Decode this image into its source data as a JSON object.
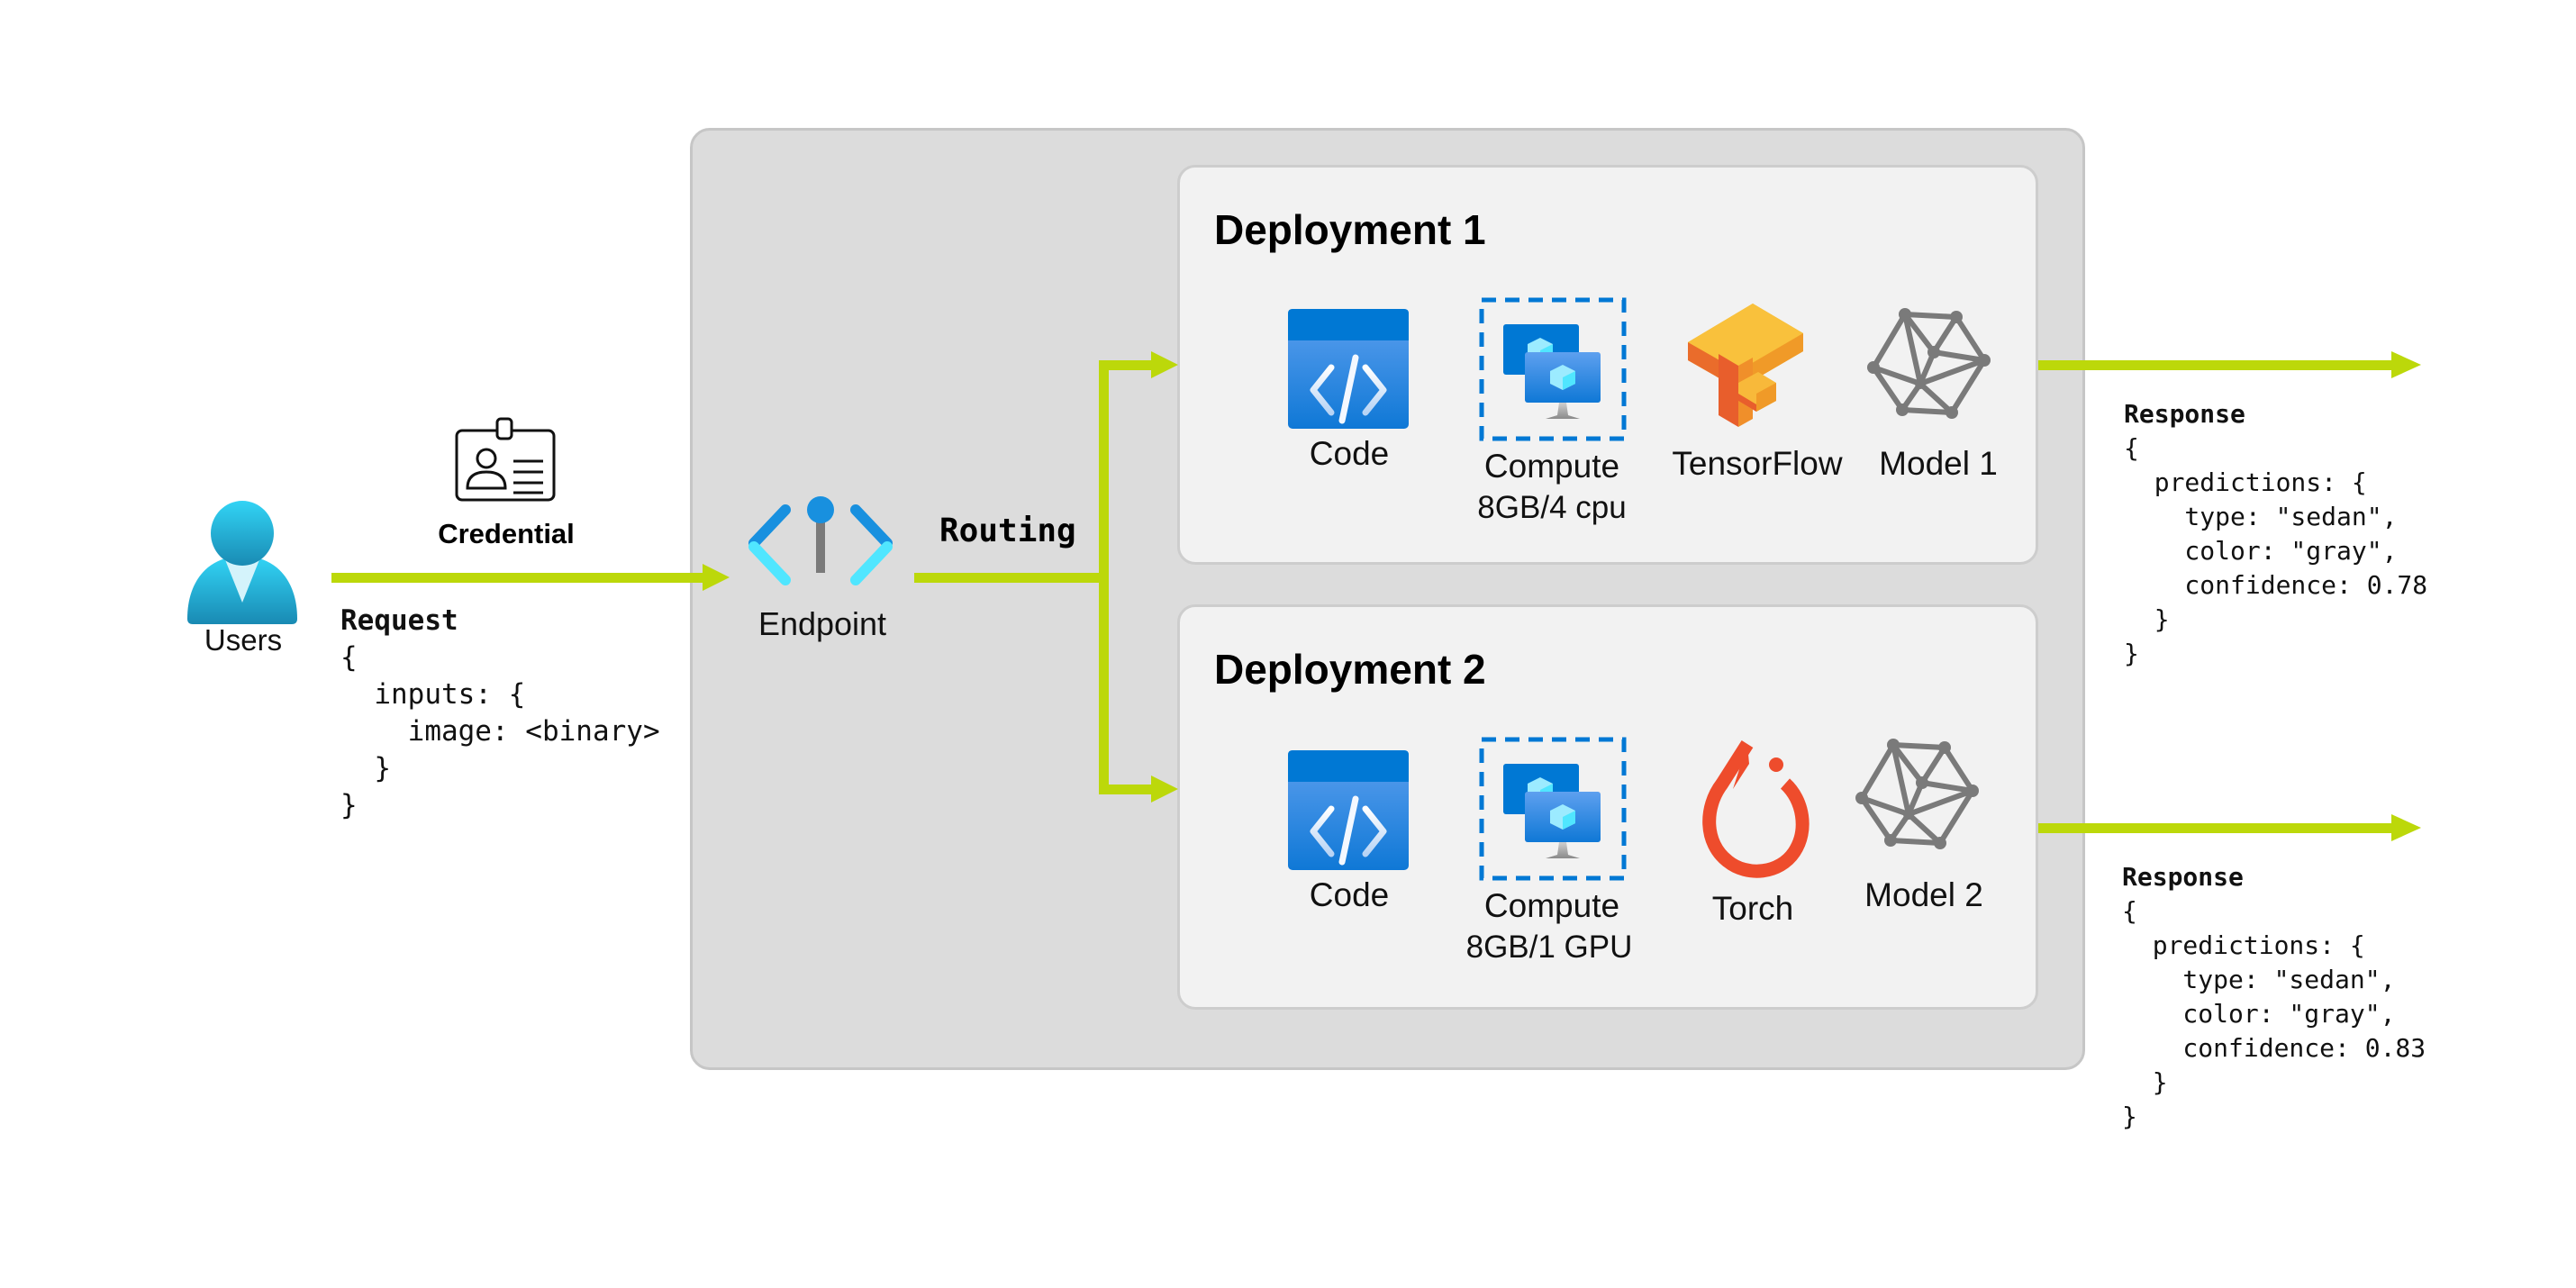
{
  "colors": {
    "arrow": "#bcd80a",
    "endpoint_bg": "#dcdcdc",
    "deployment_bg": "#f2f2f2",
    "azure_blue": "#0078d4",
    "user_cyan": "#32d4f5"
  },
  "user": {
    "icon": "user-icon",
    "label": "Users"
  },
  "credential": {
    "icon": "id-badge-icon",
    "label": "Credential"
  },
  "request": {
    "title": "Request",
    "lines": [
      "{",
      "  inputs: {",
      "    image: <binary>",
      "  }",
      "}"
    ]
  },
  "endpoint": {
    "icon": "endpoint-icon",
    "label": "Endpoint",
    "routing_label": "Routing"
  },
  "deployments": [
    {
      "title": "Deployment 1",
      "items": [
        {
          "icon": "code-icon",
          "label": "Code"
        },
        {
          "icon": "compute-icon",
          "label": "Compute",
          "sublabel": "8GB/4 cpu"
        },
        {
          "icon": "tensorflow-icon",
          "label": "TensorFlow"
        },
        {
          "icon": "model-mesh-icon",
          "label": "Model 1"
        }
      ],
      "response": {
        "title": "Response",
        "lines": [
          "{",
          "  predictions: {",
          "    type: \"sedan\",",
          "    color: \"gray\",",
          "    confidence: 0.78",
          "  }",
          "}"
        ]
      }
    },
    {
      "title": "Deployment 2",
      "items": [
        {
          "icon": "code-icon",
          "label": "Code"
        },
        {
          "icon": "compute-icon",
          "label": "Compute",
          "sublabel": "8GB/1 GPU"
        },
        {
          "icon": "pytorch-icon",
          "label": "Torch"
        },
        {
          "icon": "model-mesh-icon",
          "label": "Model 2"
        }
      ],
      "response": {
        "title": "Response",
        "lines": [
          "{",
          "  predictions: {",
          "    type: \"sedan\",",
          "    color: \"gray\",",
          "    confidence: 0.83",
          "  }",
          "}"
        ]
      }
    }
  ]
}
